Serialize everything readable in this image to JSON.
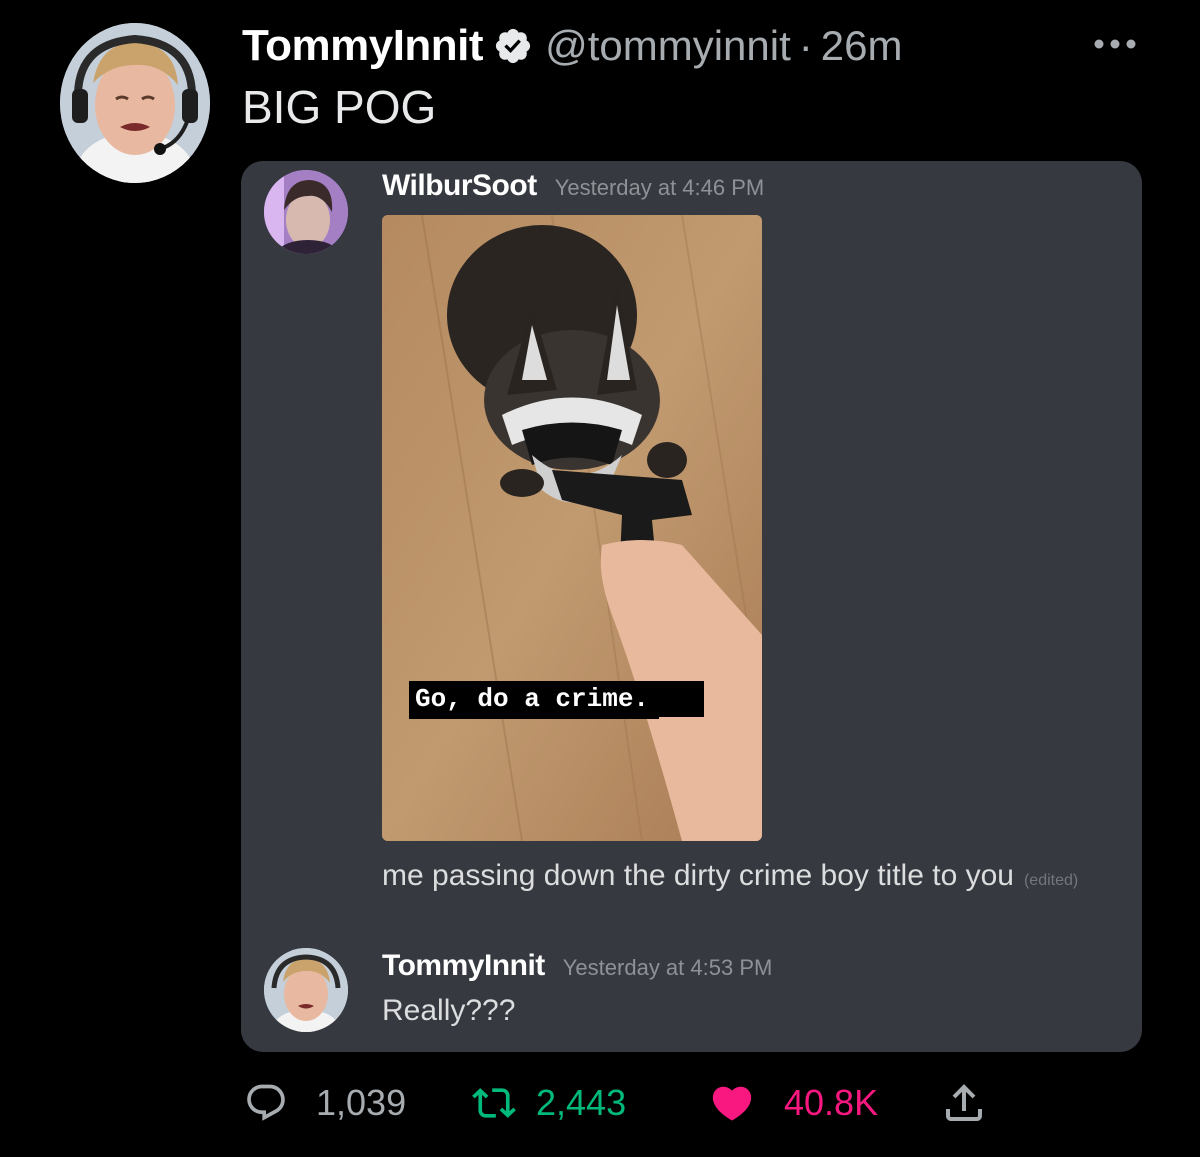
{
  "tweet": {
    "author_name": "TommyInnit",
    "handle": "@tommyinnit",
    "separator": "·",
    "time": "26m",
    "text": "BIG POG",
    "verified_icon": "verified-badge-icon",
    "more_icon": "more-options-icon"
  },
  "discord": {
    "message1": {
      "username": "WilburSoot",
      "timestamp": "Yesterday at 4:46 PM",
      "image_caption": "Go, do a crime.",
      "text": "me passing down the dirty crime boy title to you",
      "edited_label": "(edited)"
    },
    "message2": {
      "username": "TommyInnit",
      "timestamp": "Yesterday at 4:53 PM",
      "text": "Really???"
    }
  },
  "actions": {
    "replies": "1,039",
    "retweets": "2,443",
    "likes": "40.8K",
    "reply_icon": "reply-icon",
    "retweet_icon": "retweet-icon",
    "like_icon": "heart-icon",
    "share_icon": "share-icon"
  },
  "colors": {
    "background": "#000000",
    "card": "#36393f",
    "verified": "#e7e9ea",
    "retweet": "#00ba7c",
    "like": "#f91880",
    "muted": "#a7acb1"
  }
}
